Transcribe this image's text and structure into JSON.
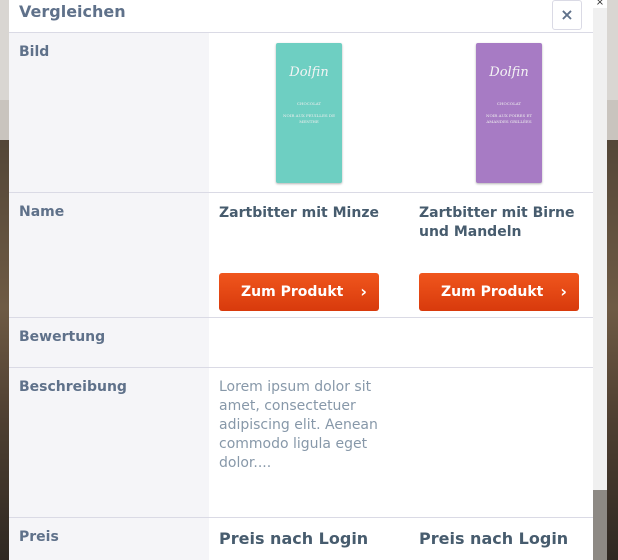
{
  "modal": {
    "title": "Vergleichen",
    "close_label": "×"
  },
  "outer_close": "×",
  "labels": {
    "image": "Bild",
    "name": "Name",
    "rating": "Bewertung",
    "description": "Beschreibung",
    "price": "Preis"
  },
  "products": [
    {
      "name": "Zartbitter mit Minze",
      "button": "Zum Produkt",
      "description": "Lorem ipsum dolor sit amet, consectetuer adipiscing elit. Aenean commodo ligula eget dolor....",
      "price": "Preis nach Login",
      "image": {
        "brand": "Dolfin",
        "color": "#6ecfc2",
        "line1": "CHOCOLAT",
        "line2": "NOIR AUX FEUILLES DE MENTHE"
      }
    },
    {
      "name": "Zartbitter mit Birne und Mandeln",
      "button": "Zum Produkt",
      "description": "",
      "price": "Preis nach Login",
      "image": {
        "brand": "Dolfin",
        "color": "#a77bc4",
        "line1": "CHOCOLAT",
        "line2": "NOIR AUX POIRES ET AMANDES GRILLÉES"
      }
    }
  ],
  "colors": {
    "accent": "#e2470f",
    "label_text": "#5f718a",
    "body_text": "#8798a9"
  }
}
